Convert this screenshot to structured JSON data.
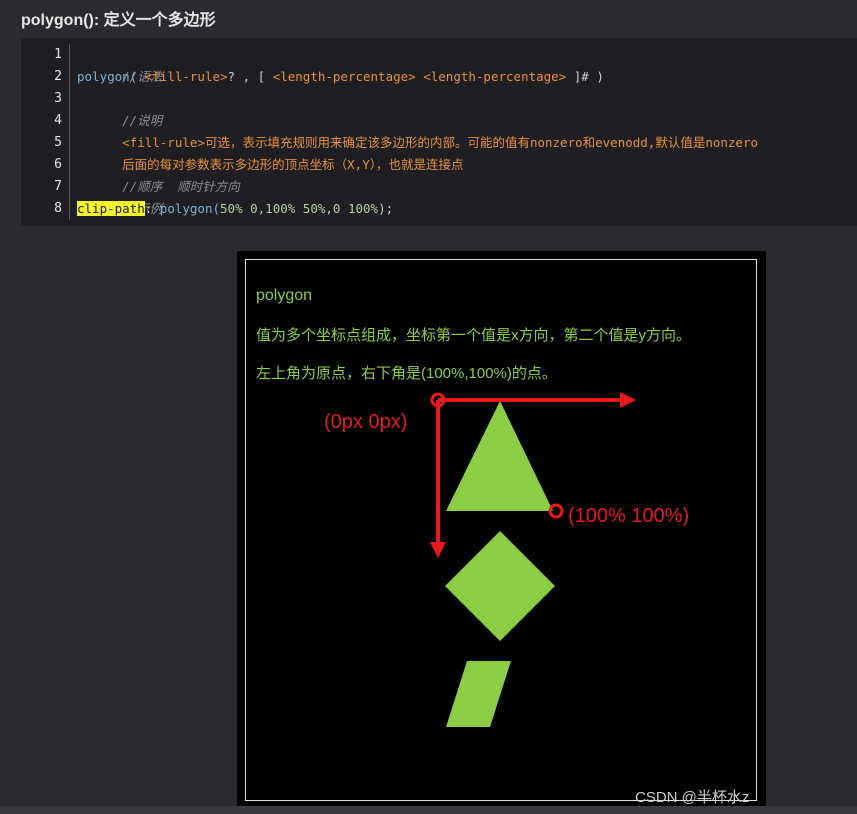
{
  "title": "polygon(): 定义一个多边形",
  "code": {
    "line_numbers": [
      "1",
      "2",
      "3",
      "4",
      "5",
      "6",
      "7",
      "8"
    ],
    "l1": "//语法",
    "l2_fn": "polygon(",
    "l2_a": " <fill-rule>",
    "l2_b": "? , [ ",
    "l2_c": "<length-percentage>",
    "l2_d": " ",
    "l2_e": "<length-percentage>",
    "l2_f": " ]# )",
    "l3": "//说明",
    "l4": "<fill-rule>可选，表示填充规则用来确定该多边形的内部。可能的值有nonzero和evenodd,默认值是nonzero",
    "l5": "后面的每对参数表示多边形的顶点坐标（X,Y），也就是连接点",
    "l6": "//顺序  顺时针方向",
    "l7": "//示例",
    "l8_prop": "clip-path",
    "l8_colon": ": ",
    "l8_fn": "polygon(",
    "l8_args": "50% 0,100% 50%,0 100%",
    "l8_end": ");"
  },
  "demo": {
    "heading": "polygon",
    "line1": "值为多个坐标点组成，坐标第一个值是x方向，第二个值是y方向。",
    "line2": "左上角为原点，右下角是(100%,100%)的点。",
    "origin_label": "(0px 0px)",
    "corner_label": "(100% 100%)"
  },
  "colors": {
    "shape_fill": "#8bcd45",
    "annotation": "#e8191c"
  },
  "watermark": "CSDN @半杯水z"
}
